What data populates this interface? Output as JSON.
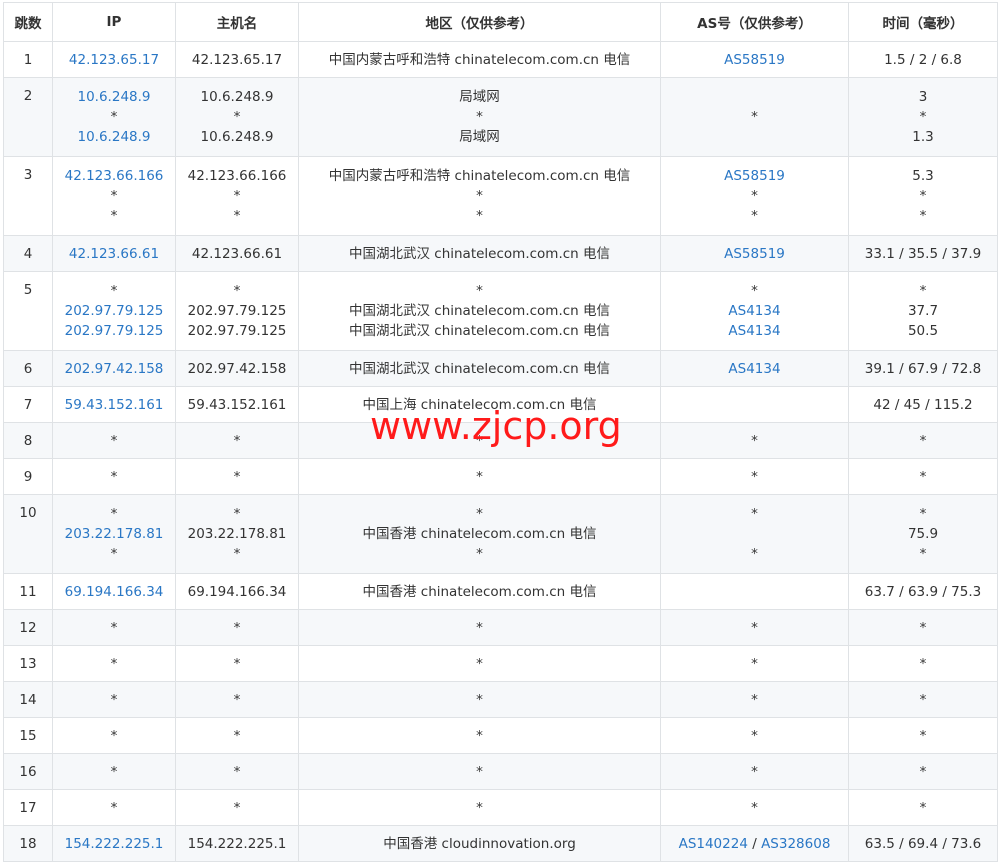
{
  "headers": [
    "跳数",
    "IP",
    "主机名",
    "地区（仅供参考）",
    "AS号（仅供参考）",
    "时间（毫秒）"
  ],
  "watermark": "www.zjcp.org",
  "colors": {
    "link": "#2a77c5",
    "watermark": "#ff1a1a",
    "stripe": "#f6f8fa",
    "border": "#dfe2e5"
  },
  "rows": [
    {
      "hop": "1",
      "h": 36,
      "ip": [
        "42.123.65.17"
      ],
      "host": [
        "42.123.65.17"
      ],
      "region": [
        "中国内蒙古呼和浩特 chinatelecom.com.cn 电信"
      ],
      "as": [
        [
          "AS58519"
        ]
      ],
      "time": [
        "1.5 / 2 / 6.8"
      ]
    },
    {
      "hop": "2",
      "h": 76,
      "ip": [
        "10.6.248.9",
        "*",
        "10.6.248.9"
      ],
      "host": [
        "10.6.248.9",
        "*",
        "10.6.248.9"
      ],
      "region": [
        "局域网",
        "*",
        "局域网"
      ],
      "as": [
        [
          "*"
        ]
      ],
      "time": [
        "3",
        "*",
        "1.3"
      ]
    },
    {
      "hop": "3",
      "h": 76,
      "ip": [
        "42.123.66.166",
        "*",
        "*"
      ],
      "host": [
        "42.123.66.166",
        "*",
        "*"
      ],
      "region": [
        "中国内蒙古呼和浩特 chinatelecom.com.cn 电信",
        "*",
        "*"
      ],
      "as": [
        [
          "AS58519"
        ],
        [
          "*"
        ],
        [
          "*"
        ]
      ],
      "time": [
        "5.3",
        "*",
        "*"
      ]
    },
    {
      "hop": "4",
      "h": 36,
      "ip": [
        "42.123.66.61"
      ],
      "host": [
        "42.123.66.61"
      ],
      "region": [
        "中国湖北武汉 chinatelecom.com.cn 电信"
      ],
      "as": [
        [
          "AS58519"
        ]
      ],
      "time": [
        "33.1 / 35.5 / 37.9"
      ]
    },
    {
      "hop": "5",
      "h": 76,
      "ip": [
        "*",
        "202.97.79.125",
        "202.97.79.125"
      ],
      "host": [
        "*",
        "202.97.79.125",
        "202.97.79.125"
      ],
      "region": [
        "*",
        "中国湖北武汉 chinatelecom.com.cn 电信",
        "中国湖北武汉 chinatelecom.com.cn 电信"
      ],
      "as": [
        [
          "*"
        ],
        [
          "AS4134"
        ],
        [
          "AS4134"
        ]
      ],
      "time": [
        "*",
        "37.7",
        "50.5"
      ]
    },
    {
      "hop": "6",
      "h": 36,
      "ip": [
        "202.97.42.158"
      ],
      "host": [
        "202.97.42.158"
      ],
      "region": [
        "中国湖北武汉 chinatelecom.com.cn 电信"
      ],
      "as": [
        [
          "AS4134"
        ]
      ],
      "time": [
        "39.1 / 67.9 / 72.8"
      ]
    },
    {
      "hop": "7",
      "h": 36,
      "ip": [
        "59.43.152.161"
      ],
      "host": [
        "59.43.152.161"
      ],
      "region": [
        "中国上海 chinatelecom.com.cn 电信"
      ],
      "as": [
        []
      ],
      "time": [
        "42 / 45 / 115.2"
      ]
    },
    {
      "hop": "8",
      "h": 36,
      "ip": [
        "*"
      ],
      "host": [
        "*"
      ],
      "region": [
        "*"
      ],
      "as": [
        [
          "*"
        ]
      ],
      "time": [
        "*"
      ]
    },
    {
      "hop": "9",
      "h": 36,
      "ip": [
        "*"
      ],
      "host": [
        "*"
      ],
      "region": [
        "*"
      ],
      "as": [
        [
          "*"
        ]
      ],
      "time": [
        "*"
      ]
    },
    {
      "hop": "10",
      "h": 76,
      "ip": [
        "*",
        "203.22.178.81",
        "*"
      ],
      "host": [
        "*",
        "203.22.178.81",
        "*"
      ],
      "region": [
        "*",
        "中国香港 chinatelecom.com.cn 电信",
        "*"
      ],
      "as": [
        [
          "*"
        ],
        [],
        [
          "*"
        ]
      ],
      "time": [
        "*",
        "75.9",
        "*"
      ]
    },
    {
      "hop": "11",
      "h": 36,
      "ip": [
        "69.194.166.34"
      ],
      "host": [
        "69.194.166.34"
      ],
      "region": [
        "中国香港 chinatelecom.com.cn 电信"
      ],
      "as": [
        []
      ],
      "time": [
        "63.7 / 63.9 / 75.3"
      ]
    },
    {
      "hop": "12",
      "h": 36,
      "ip": [
        "*"
      ],
      "host": [
        "*"
      ],
      "region": [
        "*"
      ],
      "as": [
        [
          "*"
        ]
      ],
      "time": [
        "*"
      ]
    },
    {
      "hop": "13",
      "h": 36,
      "ip": [
        "*"
      ],
      "host": [
        "*"
      ],
      "region": [
        "*"
      ],
      "as": [
        [
          "*"
        ]
      ],
      "time": [
        "*"
      ]
    },
    {
      "hop": "14",
      "h": 36,
      "ip": [
        "*"
      ],
      "host": [
        "*"
      ],
      "region": [
        "*"
      ],
      "as": [
        [
          "*"
        ]
      ],
      "time": [
        "*"
      ]
    },
    {
      "hop": "15",
      "h": 36,
      "ip": [
        "*"
      ],
      "host": [
        "*"
      ],
      "region": [
        "*"
      ],
      "as": [
        [
          "*"
        ]
      ],
      "time": [
        "*"
      ]
    },
    {
      "hop": "16",
      "h": 36,
      "ip": [
        "*"
      ],
      "host": [
        "*"
      ],
      "region": [
        "*"
      ],
      "as": [
        [
          "*"
        ]
      ],
      "time": [
        "*"
      ]
    },
    {
      "hop": "17",
      "h": 36,
      "ip": [
        "*"
      ],
      "host": [
        "*"
      ],
      "region": [
        "*"
      ],
      "as": [
        [
          "*"
        ]
      ],
      "time": [
        "*"
      ]
    },
    {
      "hop": "18",
      "h": 36,
      "ip": [
        "154.222.225.1"
      ],
      "host": [
        "154.222.225.1"
      ],
      "region": [
        "中国香港 cloudinnovation.org"
      ],
      "as": [
        [
          "AS140224",
          "AS328608"
        ]
      ],
      "time": [
        "63.5 / 69.4 / 73.6"
      ]
    }
  ]
}
